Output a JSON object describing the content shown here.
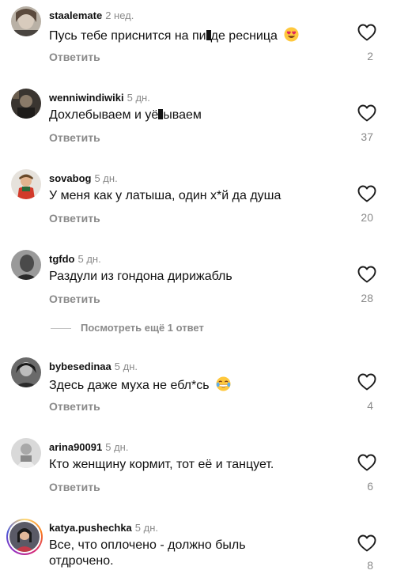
{
  "reply_label": "Ответить",
  "comments": [
    {
      "username": "staalemate",
      "time": "2 нед.",
      "text_before": "Пусь тебе приснится на пи",
      "text_after": "де ресница",
      "likes": "2"
    },
    {
      "username": "wenniwindiwiki",
      "time": "5 дн.",
      "text_before": "Дохлебываем и уё",
      "text_after": "ываем",
      "likes": "37"
    },
    {
      "username": "sovabog",
      "time": "5 дн.",
      "text": "У меня как у латыша, один х*й да душа",
      "likes": "20"
    },
    {
      "username": "tgfdo",
      "time": "5 дн.",
      "text": "Раздули из гондона дирижабль",
      "likes": "28"
    },
    {
      "username": "bybesedinaa",
      "time": "5 дн.",
      "text": "Здесь даже муха не ебл*сь",
      "likes": "4"
    },
    {
      "username": "arina90091",
      "time": "5 дн.",
      "text": "Кто женщину кормит, тот её и танцует.",
      "likes": "6"
    },
    {
      "username": "katya.pushechka",
      "time": "5 дн.",
      "text": "Все, что оплочено - должно быль отдрочено.",
      "likes": "8"
    }
  ],
  "more_replies": "Посмотреть ещё 1 ответ",
  "icons": {
    "like": "heart-outline-icon",
    "emoji_1": "heart-eyes-emoji",
    "emoji_2": "tears-of-joy-emoji"
  },
  "colors": {
    "text": "#111111",
    "secondary": "#8a8a8a"
  }
}
